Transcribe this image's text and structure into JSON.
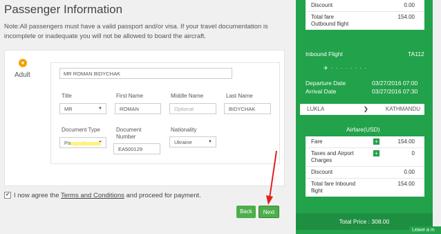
{
  "page": {
    "title": "Passenger Information",
    "note": "Note:All passengers must have a valid passport and/or visa. If your travel documentation is incomplete or inadequate you will not be allowed to board the aircraft."
  },
  "passenger": {
    "type_label": "Adult",
    "full_name": "MR ROMAN  BIDYCHAK",
    "labels": {
      "title": "Title",
      "first_name": "First Name",
      "middle_name": "Middle Name",
      "last_name": "Last Name",
      "document_type": "Document Type",
      "document_number_1": "Document",
      "document_number_2": "Number",
      "nationality": "Nationality"
    },
    "values": {
      "title": "MR",
      "first_name": "ROMAN",
      "middle_name_placeholder": "Optional",
      "last_name": "BIDYCHAK",
      "document_type": "Passport",
      "document_number": "EA500129",
      "nationality": "Ukraine"
    }
  },
  "agreement": {
    "checked": true,
    "check_mark": "✔",
    "prefix": "I now agree the ",
    "link": "Terms and Conditions",
    "suffix": " and proceed for payment."
  },
  "buttons": {
    "back": "Back",
    "next": "Next"
  },
  "outbound": {
    "discount_label": "Discount",
    "discount_value": "0.00",
    "total_label_1": "Total fare",
    "total_label_2": "Outbound flight",
    "total_value": "154.00"
  },
  "inbound": {
    "heading": "Inbound Flight",
    "flight_no": "TA112",
    "departure_label": "Departure Date",
    "departure_value": "03/27/2016 07:00",
    "arrival_label": "Arrival Date",
    "arrival_value": "03/27/2016 07:30",
    "from": "LUKLA",
    "to": "KATHMANDU",
    "airfare_heading": "Airfare(USD)",
    "fare_label": "Fare",
    "fare_value": "154.00",
    "taxes_label_1": "Taxes and Airport",
    "taxes_label_2": "Charges",
    "taxes_value": "0",
    "discount_label": "Discount",
    "discount_value": "0.00",
    "total_label_1": "Total fare Inbound",
    "total_label_2": "flight",
    "total_value": "154.00"
  },
  "total_price": "Total Price : 308.00",
  "chat_tab": "Leave a m",
  "colors": {
    "accent_green": "#22a24a",
    "highlight_yellow": "#fdf37e",
    "arrow_red": "#e02020"
  }
}
